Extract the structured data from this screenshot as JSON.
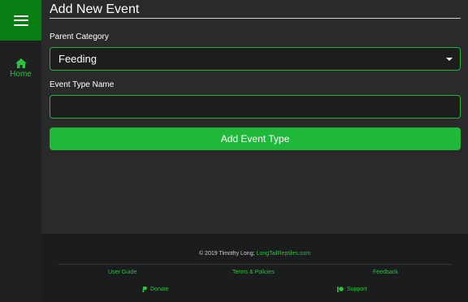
{
  "sidebar": {
    "menu_icon": "hamburger-icon",
    "home": {
      "icon": "home-icon",
      "label": "Home"
    }
  },
  "page": {
    "title": "Add New Event"
  },
  "form": {
    "parent_category": {
      "label": "Parent Category",
      "value": "Feeding"
    },
    "event_type_name": {
      "label": "Event Type Name",
      "value": "",
      "placeholder": ""
    },
    "submit_label": "Add Event Type"
  },
  "footer": {
    "copyright_prefix": "© 2019 Timothy Long;",
    "copyright_link": "LongTailReptiles.com",
    "links": {
      "user_guide": "User Guide",
      "terms": "Terms & Policies",
      "feedback": "Feedback",
      "donate": "Donate",
      "support": "Support"
    }
  },
  "colors": {
    "accent": "#20b83a",
    "menu_bg": "#0a7d12",
    "link": "#2bc23d",
    "main_bg": "#2a2a2c",
    "sidebar_bg": "#1f2022"
  }
}
